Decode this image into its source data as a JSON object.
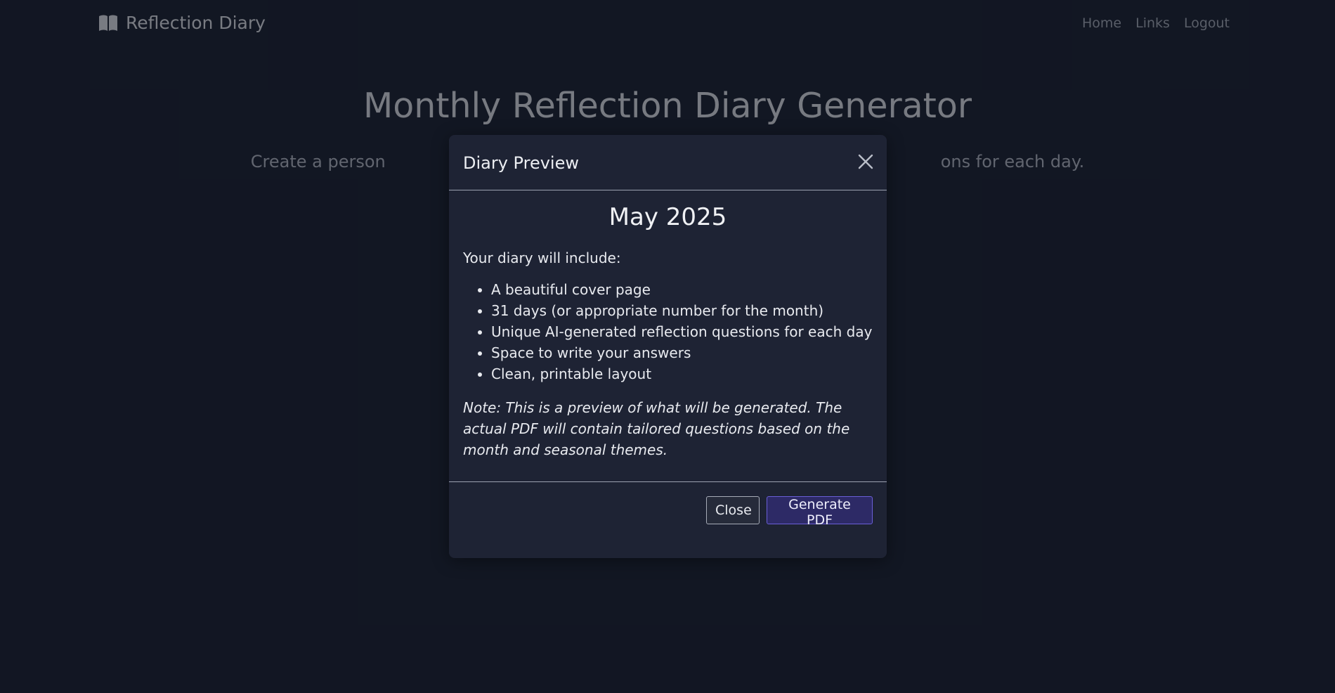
{
  "navbar": {
    "brand_icon": "open-book-icon",
    "brand_label": "Reflection Diary",
    "links": [
      {
        "label": "Home"
      },
      {
        "label": "Links"
      },
      {
        "label": "Logout"
      }
    ]
  },
  "hero": {
    "title": "Monthly Reflection Diary Generator",
    "subtitle": "Create a person                                                                    ons for each day."
  },
  "modal": {
    "title": "Diary Preview",
    "close_icon": "close-icon",
    "month": "May 2025",
    "intro": "Your diary will include:",
    "features": [
      "A beautiful cover page",
      "31 days (or appropriate number for the month)",
      "Unique AI-generated reflection questions for each day",
      "Space to write your answers",
      "Clean, printable layout"
    ],
    "note": "Note: This is a preview of what will be generated. The actual PDF will contain tailored questions based on the month and seasonal themes.",
    "buttons": {
      "close_label": "Close",
      "generate_label": "Generate PDF"
    }
  },
  "colors": {
    "page_background": "#1b2030",
    "modal_background": "#1e2334",
    "primary_button": "#2d2a66",
    "primary_border": "#6a5fd8"
  }
}
